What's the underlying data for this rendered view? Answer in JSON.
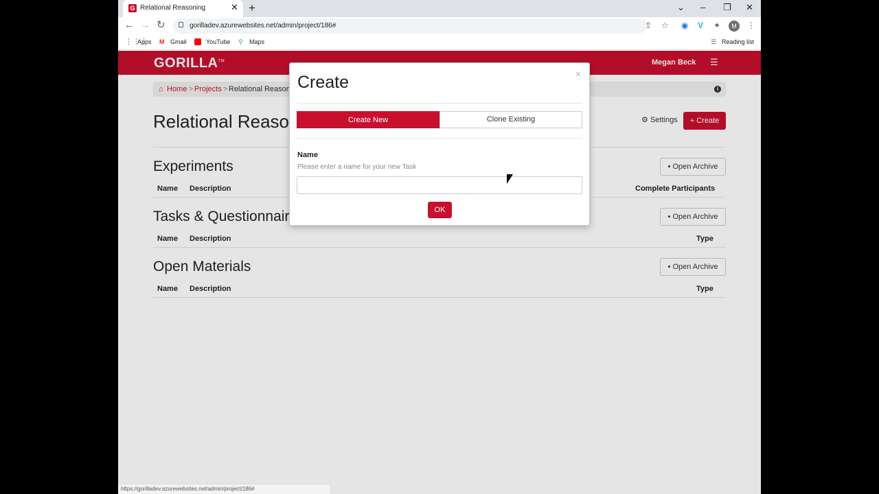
{
  "browser": {
    "tab_title": "Relational Reasoning",
    "tab_favicon": "G",
    "url": "gorilladev.azurewebsites.net/admin/project/186#",
    "avatar_letter": "M",
    "bookmarks": [
      "Apps",
      "Gmail",
      "YouTube",
      "Maps"
    ],
    "reading_list": "Reading list",
    "status_url": "https://gorilladev.azurewebsites.net/admin/project/186#"
  },
  "header": {
    "logo": "GORILLA",
    "logo_tm": "TM",
    "user": "Megan Beck"
  },
  "breadcrumb": {
    "home": "Home",
    "sep": ">",
    "projects": "Projects",
    "current": "Relational Reasoning"
  },
  "project": {
    "title": "Relational Reasoning",
    "settings_label": "Settings",
    "create_label": "Create"
  },
  "sections": {
    "experiments": {
      "title": "Experiments",
      "archive_label": "Open Archive",
      "col_name": "Name",
      "col_desc": "Description",
      "col_right": "Complete Participants"
    },
    "tasks": {
      "title": "Tasks & Questionnaires",
      "archive_label": "Open Archive",
      "col_name": "Name",
      "col_desc": "Description",
      "col_right": "Type"
    },
    "materials": {
      "title": "Open Materials",
      "archive_label": "Open Archive",
      "col_name": "Name",
      "col_desc": "Description",
      "col_right": "Type"
    }
  },
  "modal": {
    "title": "Create",
    "close": "×",
    "tab_new": "Create New",
    "tab_clone": "Clone Existing",
    "field_label": "Name",
    "field_help": "Please enter a name for your new Task",
    "input_value": "",
    "ok_label": "OK"
  },
  "colors": {
    "brand": "#c8102e"
  }
}
